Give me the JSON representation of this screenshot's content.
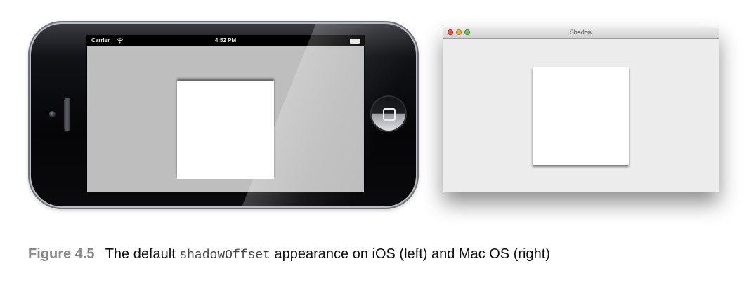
{
  "ios": {
    "status": {
      "carrier": "Carrier",
      "wifi_icon": "wifi-icon",
      "time": "4:52 PM",
      "battery_icon": "battery-icon"
    }
  },
  "mac": {
    "window_title": "Shadow",
    "buttons": [
      "close",
      "minimize",
      "zoom"
    ]
  },
  "caption": {
    "label": "Figure 4.5",
    "text_before": "The default",
    "code": "shadowOffset",
    "text_after": "appearance on iOS (left) and Mac OS (right)"
  }
}
